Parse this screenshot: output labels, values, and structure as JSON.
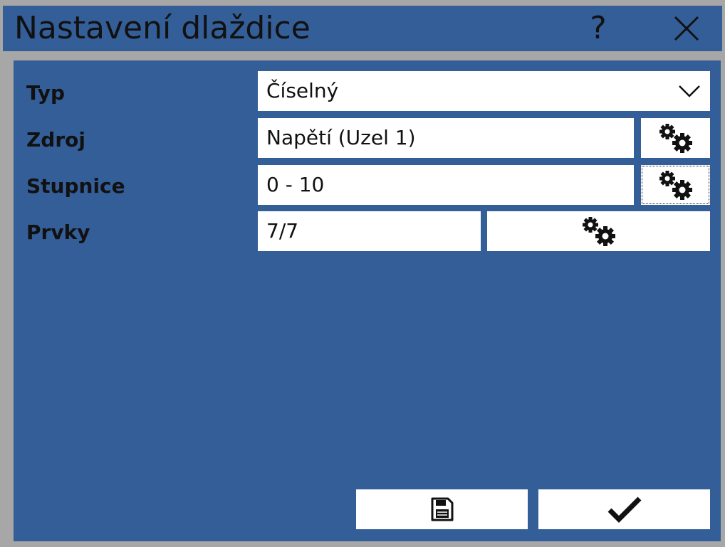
{
  "window": {
    "title": "Nastavení dlaždice",
    "help_label": "?"
  },
  "form": {
    "type": {
      "label": "Typ",
      "value": "Číselný"
    },
    "source": {
      "label": "Zdroj",
      "value": "Napětí (Uzel 1)"
    },
    "scale": {
      "label": "Stupnice",
      "value": "0 - 10"
    },
    "elements": {
      "label": "Prvky",
      "value": "7/7"
    }
  },
  "icons": {
    "help": "question-mark-icon",
    "close": "close-icon",
    "dropdown": "chevron-down-icon",
    "settings": "gears-icon",
    "save": "floppy-disk-icon",
    "confirm": "checkmark-icon"
  },
  "colors": {
    "background": "#345e98",
    "frame": "#a7a7a7",
    "field": "#ffffff",
    "text": "#111111"
  }
}
